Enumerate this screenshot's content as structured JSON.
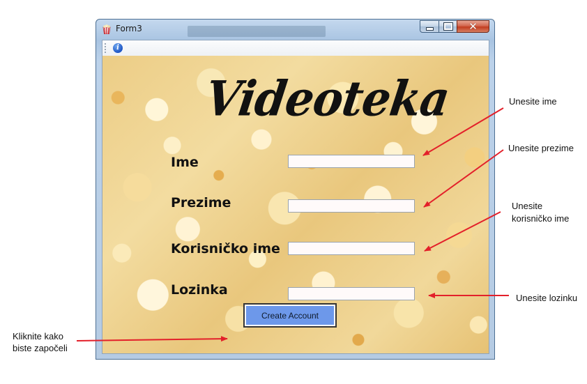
{
  "window": {
    "title": "Form3",
    "controls": {
      "minimize": "minimize",
      "maximize": "maximize",
      "close": "✕"
    }
  },
  "form": {
    "heading": "Videoteka",
    "fields": [
      {
        "label": "Ime",
        "value": "",
        "placeholder": ""
      },
      {
        "label": "Prezime",
        "value": "",
        "placeholder": ""
      },
      {
        "label": "Korisničko ime",
        "value": "",
        "placeholder": ""
      },
      {
        "label": "Lozinka",
        "value": "",
        "placeholder": ""
      }
    ],
    "submit_label": "Create Account"
  },
  "annotations": {
    "name": "Unesite ime",
    "surname": "Unesite prezime",
    "username_line1": "Unesite",
    "username_line2": "korisničko ime",
    "password": "Unesite lozinku",
    "button_line1": "Kliknite kako",
    "button_line2": "biste započeli"
  },
  "colors": {
    "arrow": "#e3202a",
    "button": "#6d98ea",
    "close_button": "#c23d1f"
  }
}
